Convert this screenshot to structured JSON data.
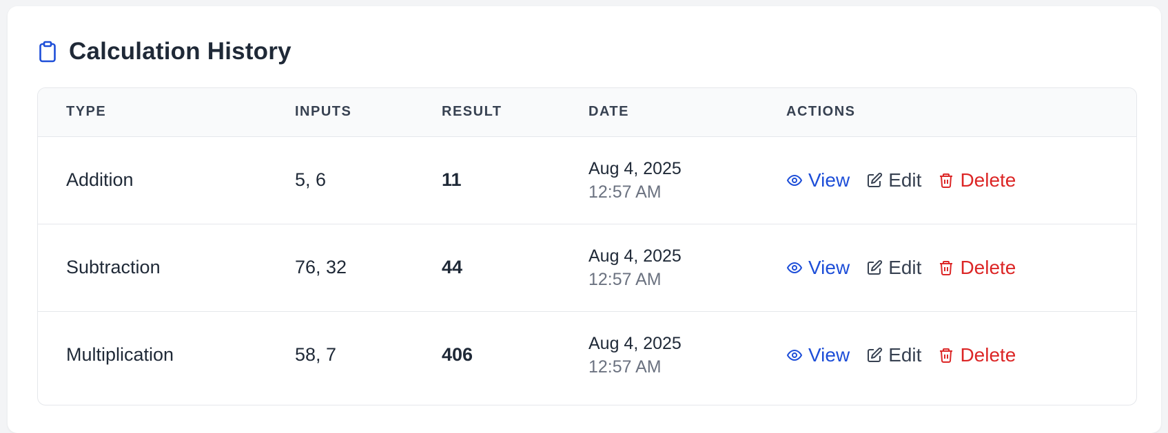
{
  "header": {
    "title": "Calculation History",
    "icon": "clipboard-icon",
    "icon_color": "#1d4ed8"
  },
  "table": {
    "columns": [
      "TYPE",
      "INPUTS",
      "RESULT",
      "DATE",
      "ACTIONS"
    ],
    "rows": [
      {
        "type": "Addition",
        "inputs": "5, 6",
        "result": "11",
        "date": "Aug 4, 2025",
        "time": "12:57 AM"
      },
      {
        "type": "Subtraction",
        "inputs": "76, 32",
        "result": "44",
        "date": "Aug 4, 2025",
        "time": "12:57 AM"
      },
      {
        "type": "Multiplication",
        "inputs": "58, 7",
        "result": "406",
        "date": "Aug 4, 2025",
        "time": "12:57 AM"
      }
    ]
  },
  "actions": {
    "view_label": "View",
    "edit_label": "Edit",
    "delete_label": "Delete",
    "view_icon": "eye-icon",
    "edit_icon": "pencil-square-icon",
    "delete_icon": "trash-icon"
  },
  "colors": {
    "view": "#1d4ed8",
    "edit": "#374151",
    "delete": "#dc2626",
    "header_bg": "#f9fafb"
  }
}
